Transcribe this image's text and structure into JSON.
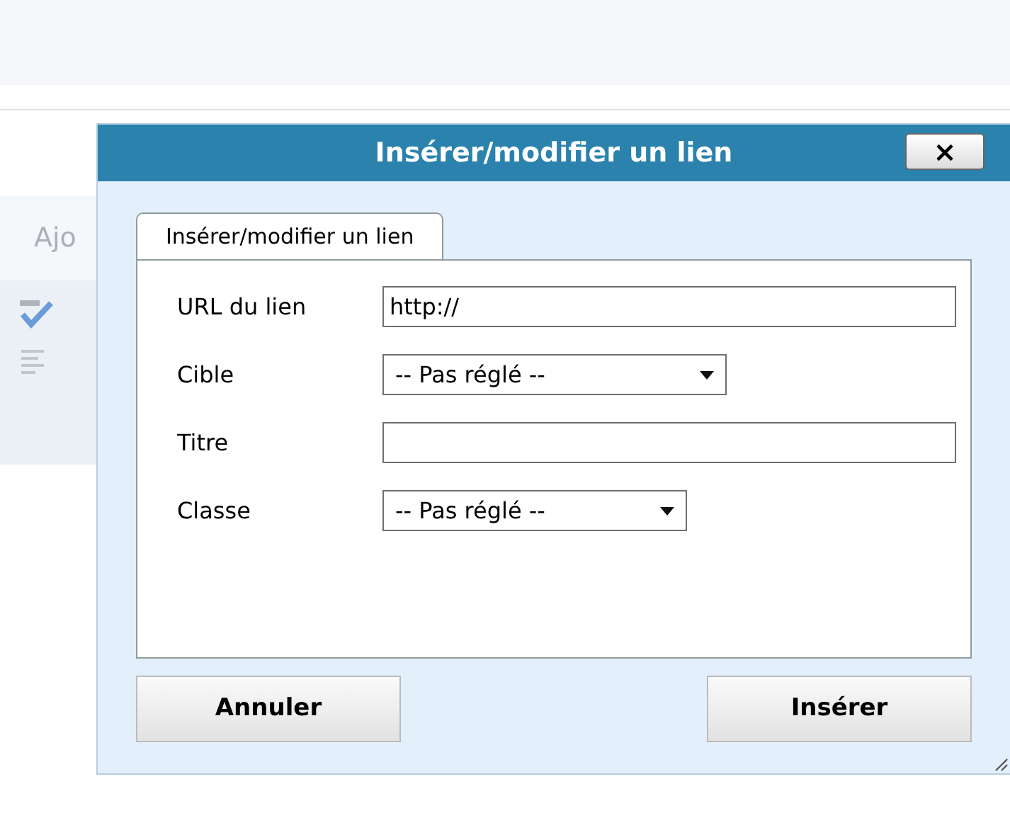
{
  "background": {
    "tab_label": "Ajo"
  },
  "dialog": {
    "title": "Insérer/modifier un lien",
    "close": "×",
    "tabs": [
      {
        "label": "Insérer/modifier un lien",
        "selected": true
      }
    ],
    "fields": [
      {
        "kind": "text",
        "label": "URL du lien",
        "value": "http://"
      },
      {
        "kind": "select",
        "label": "Cible",
        "value": "-- Pas réglé --"
      },
      {
        "kind": "text",
        "label": "Titre"
      },
      {
        "kind": "select",
        "label": "Classe",
        "value": "-- Pas réglé --"
      }
    ],
    "buttons": [
      "Annuler",
      "Insérer"
    ]
  }
}
